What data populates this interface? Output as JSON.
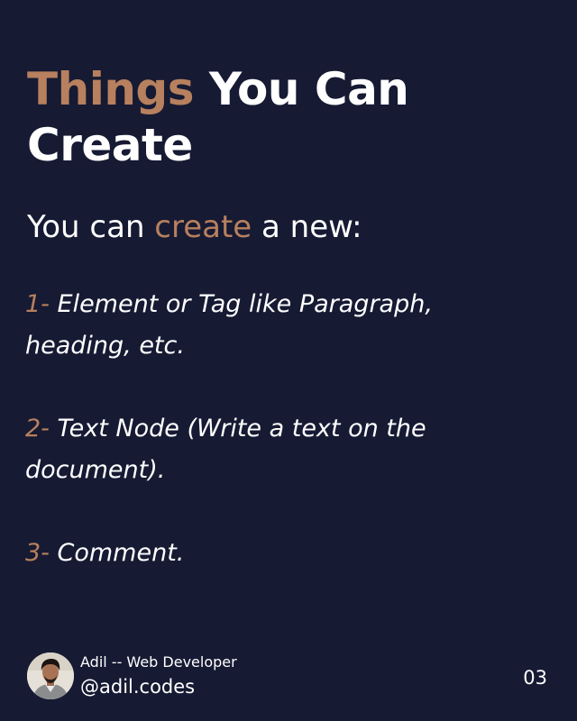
{
  "title": {
    "accent": "Things",
    "rest_line1": " You Can",
    "rest_line2": "Create"
  },
  "intro": {
    "before": "You can ",
    "accent": "create",
    "after": " a new:"
  },
  "items": [
    {
      "number": "1-",
      "text": " Element or Tag like Paragraph, heading, etc."
    },
    {
      "number": "2-",
      "text": " Text Node (Write a text on the document)."
    },
    {
      "number": "3-",
      "text": " Comment."
    }
  ],
  "footer": {
    "name": "Adil -- Web Developer",
    "handle": "@adil.codes",
    "page": "03"
  },
  "colors": {
    "background": "#161a33",
    "accent": "#b7805e",
    "text": "#ffffff"
  },
  "icons": {
    "avatar": "author-avatar"
  }
}
